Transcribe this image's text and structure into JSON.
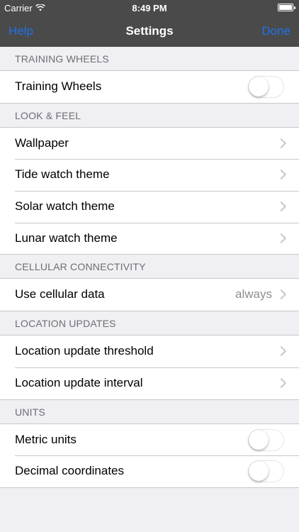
{
  "status_bar": {
    "carrier": "Carrier",
    "time": "8:49 PM",
    "battery_level": 1.0
  },
  "nav": {
    "left_button": "Help",
    "title": "Settings",
    "right_button": "Done"
  },
  "colors": {
    "accent": "#1e72e8",
    "nav_background": "#4a4a4a",
    "group_background": "#efeff4"
  },
  "sections": {
    "training": {
      "header": "TRAINING WHEELS",
      "rows": {
        "training_wheels": {
          "label": "Training Wheels",
          "on": false
        }
      }
    },
    "look": {
      "header": "LOOK & FEEL",
      "rows": {
        "wallpaper": {
          "label": "Wallpaper"
        },
        "tide": {
          "label": "Tide watch theme"
        },
        "solar": {
          "label": "Solar watch theme"
        },
        "lunar": {
          "label": "Lunar watch theme"
        }
      }
    },
    "cellular": {
      "header": "CELLULAR CONNECTIVITY",
      "rows": {
        "use_cellular": {
          "label": "Use cellular data",
          "value": "always"
        }
      }
    },
    "location": {
      "header": "LOCATION UPDATES",
      "rows": {
        "threshold": {
          "label": "Location update threshold"
        },
        "interval": {
          "label": "Location update interval"
        }
      }
    },
    "units": {
      "header": "UNITS",
      "rows": {
        "metric": {
          "label": "Metric units",
          "on": false
        },
        "decimal": {
          "label": "Decimal coordinates",
          "on": false
        }
      }
    }
  }
}
